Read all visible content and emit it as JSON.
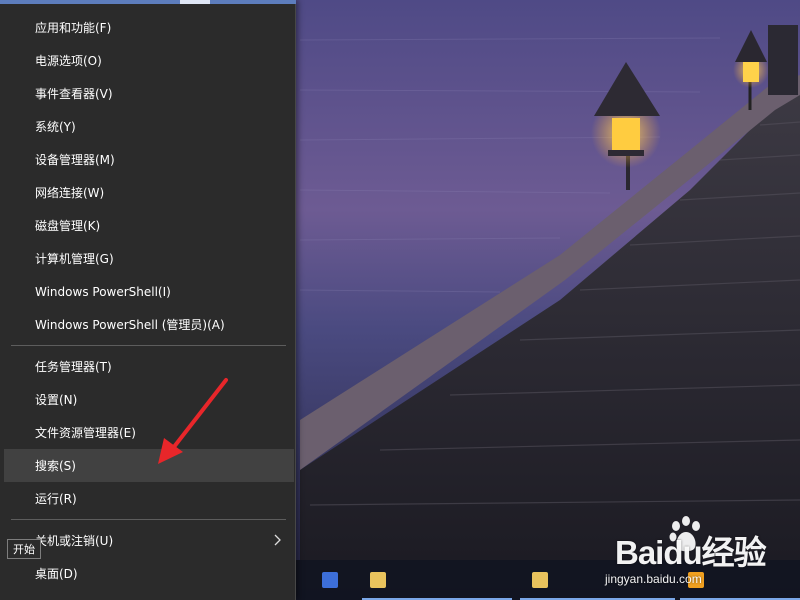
{
  "menu": {
    "items": [
      {
        "label": "应用和功能(F)"
      },
      {
        "label": "电源选项(O)"
      },
      {
        "label": "事件查看器(V)"
      },
      {
        "label": "系统(Y)"
      },
      {
        "label": "设备管理器(M)"
      },
      {
        "label": "网络连接(W)"
      },
      {
        "label": "磁盘管理(K)"
      },
      {
        "label": "计算机管理(G)"
      },
      {
        "label": "Windows PowerShell(I)"
      },
      {
        "label": "Windows PowerShell (管理员)(A)"
      },
      {
        "label": "任务管理器(T)"
      },
      {
        "label": "设置(N)"
      },
      {
        "label": "文件资源管理器(E)"
      },
      {
        "label": "搜索(S)"
      },
      {
        "label": "运行(R)"
      },
      {
        "label": "关机或注销(U)"
      },
      {
        "label": "桌面(D)"
      }
    ],
    "highlighted_label": "搜索(S)"
  },
  "tooltip": {
    "text": "开始"
  },
  "watermark": {
    "logo": "Baidu经验",
    "url": "jingyan.baidu.com"
  },
  "colors": {
    "menu_bg": "#2b2b2b",
    "menu_highlight": "#414141",
    "menu_separator": "#5d5d5d",
    "annotation_arrow": "#e8262a",
    "taskbar_bg": "#10141e"
  }
}
